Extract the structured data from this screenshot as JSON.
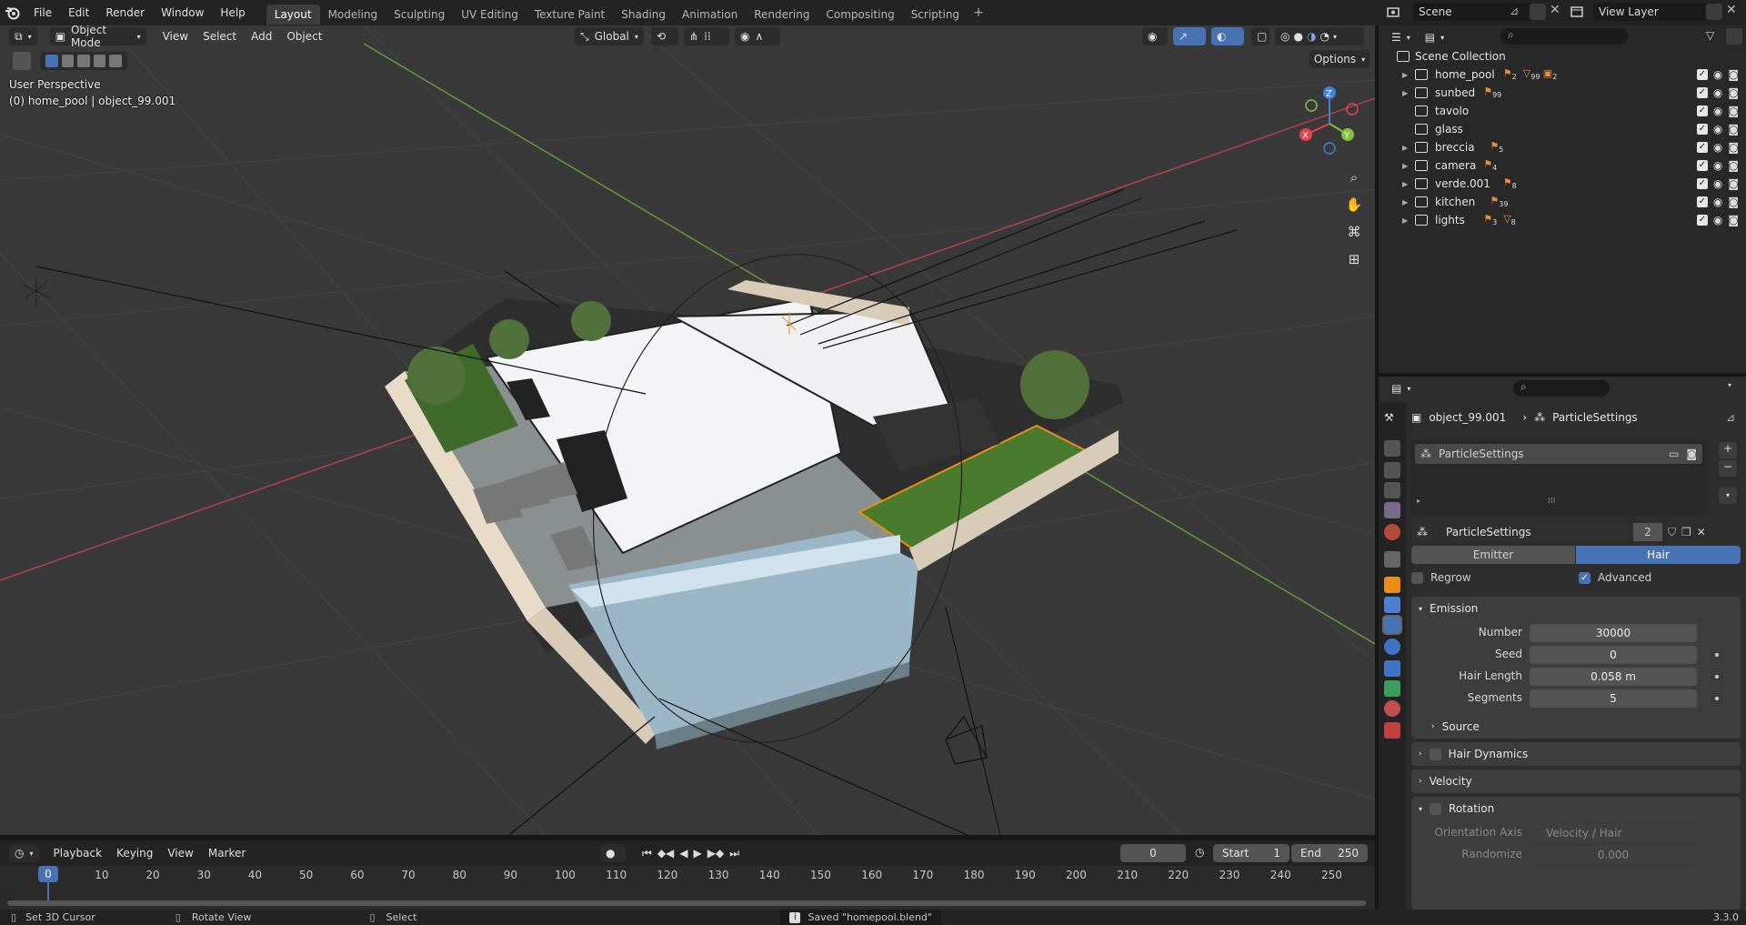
{
  "menus": [
    "File",
    "Edit",
    "Render",
    "Window",
    "Help"
  ],
  "workspaces": [
    {
      "label": "Layout",
      "active": true
    },
    {
      "label": "Modeling"
    },
    {
      "label": "Sculpting"
    },
    {
      "label": "UV Editing"
    },
    {
      "label": "Texture Paint"
    },
    {
      "label": "Shading"
    },
    {
      "label": "Animation"
    },
    {
      "label": "Rendering"
    },
    {
      "label": "Compositing"
    },
    {
      "label": "Scripting"
    }
  ],
  "scene": {
    "name": "Scene",
    "view_layer": "View Layer"
  },
  "viewport": {
    "mode": "Object Mode",
    "menus": [
      "View",
      "Select",
      "Add",
      "Object"
    ],
    "orientation": "Global",
    "options_label": "Options",
    "perspective": "User Perspective",
    "active_info": "(0) home_pool | object_99.001",
    "gizmo": {
      "z": "Z",
      "y": "Y",
      "x": "X"
    },
    "axis_colors": {
      "x": "#e9424f",
      "y": "#7fc33b",
      "z": "#3d82d8"
    }
  },
  "outliner": {
    "root": "Scene Collection",
    "collections": [
      {
        "name": "home_pool",
        "badges": [
          "2",
          "99",
          "2"
        ],
        "expandable": true
      },
      {
        "name": "sunbed",
        "badges": [
          "99"
        ],
        "expandable": true
      },
      {
        "name": "tavolo",
        "badges": [],
        "expandable": false
      },
      {
        "name": "glass",
        "badges": [],
        "expandable": false
      },
      {
        "name": "breccia",
        "badges": [
          "5"
        ],
        "expandable": true
      },
      {
        "name": "camera",
        "badges": [
          "4"
        ],
        "expandable": true
      },
      {
        "name": "verde.001",
        "badges": [
          "8"
        ],
        "expandable": true
      },
      {
        "name": "kitchen",
        "badges": [
          "39"
        ],
        "expandable": true
      },
      {
        "name": "lights",
        "badges": [
          "3",
          "8"
        ],
        "expandable": true
      }
    ]
  },
  "properties": {
    "breadcrumb_object": "object_99.001",
    "breadcrumb_settings": "ParticleSettings",
    "list_item": "ParticleSettings",
    "settings_name": "ParticleSettings",
    "users": "2",
    "type_tabs": [
      {
        "label": "Emitter",
        "active": false
      },
      {
        "label": "Hair",
        "active": true
      }
    ],
    "regrow_label": "Regrow",
    "regrow": false,
    "advanced_label": "Advanced",
    "advanced": true,
    "emission": {
      "title": "Emission",
      "fields": [
        {
          "label": "Number",
          "value": "30000"
        },
        {
          "label": "Seed",
          "value": "0"
        },
        {
          "label": "Hair Length",
          "value": "0.058 m"
        },
        {
          "label": "Segments",
          "value": "5"
        }
      ],
      "source": "Source"
    },
    "hair_dynamics": "Hair Dynamics",
    "velocity": "Velocity",
    "rotation": {
      "title": "Rotation",
      "orientation_label": "Orientation Axis",
      "orientation_value": "Velocity / Hair",
      "randomize_label": "Randomize",
      "randomize_value": "0.000"
    }
  },
  "timeline": {
    "menus": [
      "Playback",
      "Keying",
      "View",
      "Marker"
    ],
    "current_frame": "0",
    "start_label": "Start",
    "start": "1",
    "end_label": "End",
    "end": "250",
    "ticks": [
      "0",
      "10",
      "20",
      "30",
      "40",
      "50",
      "60",
      "70",
      "80",
      "90",
      "100",
      "110",
      "120",
      "130",
      "140",
      "150",
      "160",
      "170",
      "180",
      "190",
      "200",
      "210",
      "220",
      "230",
      "240",
      "250"
    ]
  },
  "statusbar": {
    "left1": "Set 3D Cursor",
    "left2": "Rotate View",
    "left3": "Select",
    "message": "Saved \"homepool.blend\"",
    "version": "3.3.0"
  }
}
